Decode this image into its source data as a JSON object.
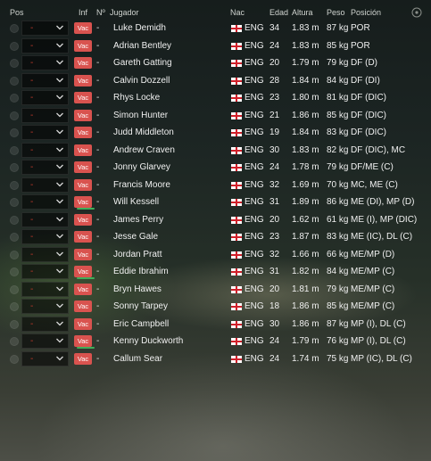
{
  "headers": {
    "pos": "Pos",
    "inf": "Inf",
    "num": "Nº",
    "player": "Jugador",
    "nat": "Nac",
    "age": "Edad",
    "height": "Altura",
    "weight": "Peso",
    "position": "Posición"
  },
  "header_icon": "settings-circle-icon",
  "colors": {
    "badge": "#d9534f",
    "injury_bar": "#3fae5a",
    "flag_cross": "#d0202a",
    "dash": "#c0392b"
  },
  "players": [
    {
      "sel": "-",
      "badge": "Vac",
      "inj": false,
      "num": "-",
      "name": "Luke Demidh",
      "nat": "ENG",
      "age": "34",
      "height": "1.83 m",
      "weight": "87 kg",
      "position": "POR"
    },
    {
      "sel": "-",
      "badge": "Vac",
      "inj": false,
      "num": "-",
      "name": "Adrian Bentley",
      "nat": "ENG",
      "age": "24",
      "height": "1.83 m",
      "weight": "85 kg",
      "position": "POR"
    },
    {
      "sel": "-",
      "badge": "Vac",
      "inj": false,
      "num": "-",
      "name": "Gareth Gatting",
      "nat": "ENG",
      "age": "20",
      "height": "1.79 m",
      "weight": "79 kg",
      "position": "DF (D)"
    },
    {
      "sel": "-",
      "badge": "Vac",
      "inj": false,
      "num": "-",
      "name": "Calvin Dozzell",
      "nat": "ENG",
      "age": "28",
      "height": "1.84 m",
      "weight": "84 kg",
      "position": "DF (DI)"
    },
    {
      "sel": "-",
      "badge": "Vac",
      "inj": false,
      "num": "-",
      "name": "Rhys Locke",
      "nat": "ENG",
      "age": "23",
      "height": "1.80 m",
      "weight": "81 kg",
      "position": "DF (DIC)"
    },
    {
      "sel": "-",
      "badge": "Vac",
      "inj": false,
      "num": "-",
      "name": "Simon Hunter",
      "nat": "ENG",
      "age": "21",
      "height": "1.86 m",
      "weight": "85 kg",
      "position": "DF (DIC)"
    },
    {
      "sel": "-",
      "badge": "Vac",
      "inj": false,
      "num": "-",
      "name": "Judd Middleton",
      "nat": "ENG",
      "age": "19",
      "height": "1.84 m",
      "weight": "83 kg",
      "position": "DF (DIC)"
    },
    {
      "sel": "-",
      "badge": "Vac",
      "inj": false,
      "num": "-",
      "name": "Andrew Craven",
      "nat": "ENG",
      "age": "30",
      "height": "1.83 m",
      "weight": "82 kg",
      "position": "DF (DIC), MC"
    },
    {
      "sel": "-",
      "badge": "Vac",
      "inj": false,
      "num": "-",
      "name": "Jonny Glarvey",
      "nat": "ENG",
      "age": "24",
      "height": "1.78 m",
      "weight": "79 kg",
      "position": "DF/ME (C)"
    },
    {
      "sel": "-",
      "badge": "Vac",
      "inj": false,
      "num": "-",
      "name": "Francis Moore",
      "nat": "ENG",
      "age": "32",
      "height": "1.69 m",
      "weight": "70 kg",
      "position": "MC, ME (C)"
    },
    {
      "sel": "-",
      "badge": "Vac",
      "inj": true,
      "num": "-",
      "name": "Will Kessell",
      "nat": "ENG",
      "age": "31",
      "height": "1.89 m",
      "weight": "86 kg",
      "position": "ME (DI), MP (D)"
    },
    {
      "sel": "-",
      "badge": "Vac",
      "inj": false,
      "num": "-",
      "name": "James Perry",
      "nat": "ENG",
      "age": "20",
      "height": "1.62 m",
      "weight": "61 kg",
      "position": "ME (I), MP (DIC)"
    },
    {
      "sel": "-",
      "badge": "Vac",
      "inj": false,
      "num": "-",
      "name": "Jesse Gale",
      "nat": "ENG",
      "age": "23",
      "height": "1.87 m",
      "weight": "83 kg",
      "position": "ME (IC), DL (C)"
    },
    {
      "sel": "-",
      "badge": "Vac",
      "inj": false,
      "num": "-",
      "name": "Jordan Pratt",
      "nat": "ENG",
      "age": "32",
      "height": "1.66 m",
      "weight": "66 kg",
      "position": "ME/MP (D)"
    },
    {
      "sel": "-",
      "badge": "Vac",
      "inj": true,
      "num": "-",
      "name": "Eddie Ibrahim",
      "nat": "ENG",
      "age": "31",
      "height": "1.82 m",
      "weight": "84 kg",
      "position": "ME/MP (C)"
    },
    {
      "sel": "-",
      "badge": "Vac",
      "inj": false,
      "num": "-",
      "name": "Bryn Hawes",
      "nat": "ENG",
      "age": "20",
      "height": "1.81 m",
      "weight": "79 kg",
      "position": "ME/MP (C)"
    },
    {
      "sel": "-",
      "badge": "Vac",
      "inj": false,
      "num": "-",
      "name": "Sonny Tarpey",
      "nat": "ENG",
      "age": "18",
      "height": "1.86 m",
      "weight": "85 kg",
      "position": "ME/MP (C)"
    },
    {
      "sel": "-",
      "badge": "Vac",
      "inj": false,
      "num": "-",
      "name": "Eric Campbell",
      "nat": "ENG",
      "age": "30",
      "height": "1.86 m",
      "weight": "87 kg",
      "position": "MP (I), DL (C)"
    },
    {
      "sel": "-",
      "badge": "Vac",
      "inj": true,
      "num": "-",
      "name": "Kenny Duckworth",
      "nat": "ENG",
      "age": "24",
      "height": "1.79 m",
      "weight": "76 kg",
      "position": "MP (I), DL (C)"
    },
    {
      "sel": "-",
      "badge": "Vac",
      "inj": false,
      "num": "-",
      "name": "Callum Sear",
      "nat": "ENG",
      "age": "24",
      "height": "1.74 m",
      "weight": "75 kg",
      "position": "MP (IC), DL (C)"
    }
  ]
}
